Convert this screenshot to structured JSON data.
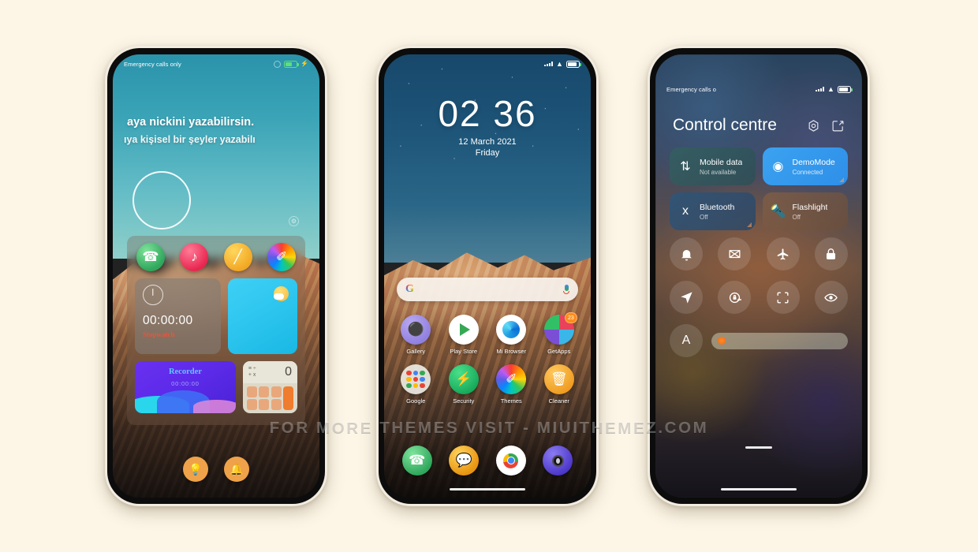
{
  "background_color": "#fdf6e7",
  "watermark": "FOR MORE THEMES VISIT - MIUITHEMEZ.COM",
  "phone1": {
    "status_bar": {
      "carrier": "Emergency calls only",
      "battery_icon": "battery-charging-icon"
    },
    "lockscreen": {
      "line1": "aya nickini yazabilirsin.",
      "line2": "ıya kişisel bir şeyler yazabilı"
    },
    "widget_icons": [
      {
        "name": "phone-icon",
        "glyph": "☎"
      },
      {
        "name": "music-note-icon",
        "glyph": "♪"
      },
      {
        "name": "pencil-icon",
        "glyph": "╱"
      },
      {
        "name": "themes-brush-icon",
        "glyph": "✐"
      }
    ],
    "stopwatch_widget": {
      "time": "00:00:00",
      "label": "Stopwatch"
    },
    "weather_widget": {
      "label": "weather"
    },
    "recorder_widget": {
      "title": "Recorder",
      "time": "00:00:00"
    },
    "calculator_widget": {
      "display": "0",
      "ops_top": "≡ ÷",
      "ops_bottom": "+ x"
    },
    "bottom_buttons": [
      {
        "name": "flashlight-button",
        "glyph": "▮"
      },
      {
        "name": "notification-bell-button",
        "glyph": "ὑ4"
      }
    ]
  },
  "phone2": {
    "status_bar": {
      "signal_icon": "signal-dots-icon",
      "wifi_icon": "wifi-icon",
      "battery_icon": "battery-icon"
    },
    "clock": {
      "time": "02 36",
      "date": "12 March 2021",
      "day": "Friday"
    },
    "search": {
      "placeholder": "",
      "logo": "google-g-logo",
      "mic": "microphone-icon"
    },
    "apps_row1": [
      {
        "label": "Gallery",
        "icon": "gallery-icon",
        "badge": ""
      },
      {
        "label": "Play Store",
        "icon": "play-store-icon",
        "badge": ""
      },
      {
        "label": "Mi Browser",
        "icon": "mi-browser-icon",
        "badge": ""
      },
      {
        "label": "GetApps",
        "icon": "getapps-icon",
        "badge": "23"
      }
    ],
    "apps_row2": [
      {
        "label": "Google",
        "icon": "google-folder-icon",
        "badge": ""
      },
      {
        "label": "Security",
        "icon": "security-icon",
        "badge": ""
      },
      {
        "label": "Themes",
        "icon": "themes-icon",
        "badge": ""
      },
      {
        "label": "Cleaner",
        "icon": "cleaner-icon",
        "badge": ""
      }
    ],
    "dock": [
      {
        "name": "phone-app-icon"
      },
      {
        "name": "messages-app-icon"
      },
      {
        "name": "chrome-app-icon"
      },
      {
        "name": "camera-app-icon"
      }
    ]
  },
  "phone3": {
    "status_bar": {
      "carrier": "Emergency calls o",
      "signal_icon": "signal-dots-icon",
      "wifi_icon": "wifi-icon",
      "battery_icon": "battery-icon"
    },
    "title": "Control centre",
    "header_actions": [
      {
        "name": "settings-gear-icon"
      },
      {
        "name": "edit-icon"
      }
    ],
    "tiles": [
      {
        "name": "Mobile data",
        "status": "Not available",
        "icon": "mobile-data-icon",
        "active": false
      },
      {
        "name": "DemoMode",
        "status": "Connected",
        "icon": "wifi-icon",
        "active": true
      },
      {
        "name": "Bluetooth",
        "status": "Off",
        "icon": "bluetooth-icon",
        "active": false
      },
      {
        "name": "Flashlight",
        "status": "Off",
        "icon": "flashlight-icon",
        "active": false
      }
    ],
    "toggles_row1": [
      {
        "name": "silent-bell-icon"
      },
      {
        "name": "screenshot-icon"
      },
      {
        "name": "airplane-mode-icon"
      },
      {
        "name": "lock-icon"
      }
    ],
    "toggles_row2": [
      {
        "name": "location-icon"
      },
      {
        "name": "auto-rotate-lock-icon"
      },
      {
        "name": "scan-qr-icon"
      },
      {
        "name": "reading-mode-eye-icon"
      }
    ],
    "brightness": {
      "auto_label": "A",
      "level_percent": 8
    }
  }
}
